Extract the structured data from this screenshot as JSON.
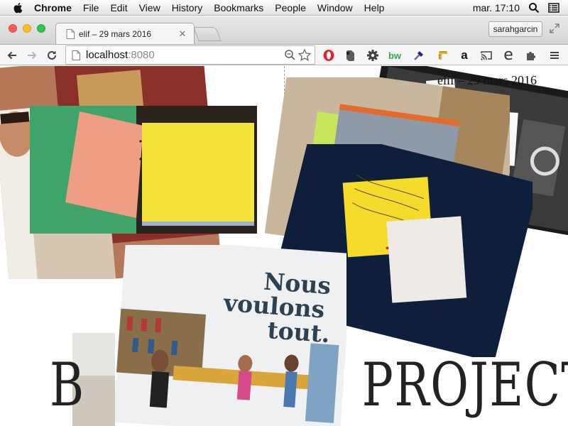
{
  "menubar": {
    "app": "Chrome",
    "items": [
      "File",
      "Edit",
      "View",
      "History",
      "Bookmarks",
      "People",
      "Window",
      "Help"
    ],
    "clock": "mar. 17:10"
  },
  "tab": {
    "title": "elif – 29 mars 2016"
  },
  "profile": "sarahgarcin",
  "address": {
    "host": "localhost",
    "port": ":8080"
  },
  "page": {
    "site_title": "elif – 29 mars 2016",
    "banner_visible": "PROJECTS",
    "banner_left": "B",
    "poster_line1": "Nous",
    "poster_line2": "voulons",
    "poster_line3": "tout."
  },
  "extensions": [
    "opera-icon",
    "evernote-icon",
    "gear-icon",
    "bw-icon",
    "eyedropper-icon",
    "ruler-icon",
    "amazon-icon",
    "cast-icon",
    "e-icon",
    "puzzle-icon",
    "hamburger-menu-icon"
  ],
  "colors": {
    "accent_green": "#2fa84f",
    "opera_red": "#e0242b",
    "yellow_paper": "#f3e33a",
    "salmon_paper": "#ef9e86",
    "green_paper": "#3fa36a",
    "navy_cloth": "#0f1e3a"
  }
}
